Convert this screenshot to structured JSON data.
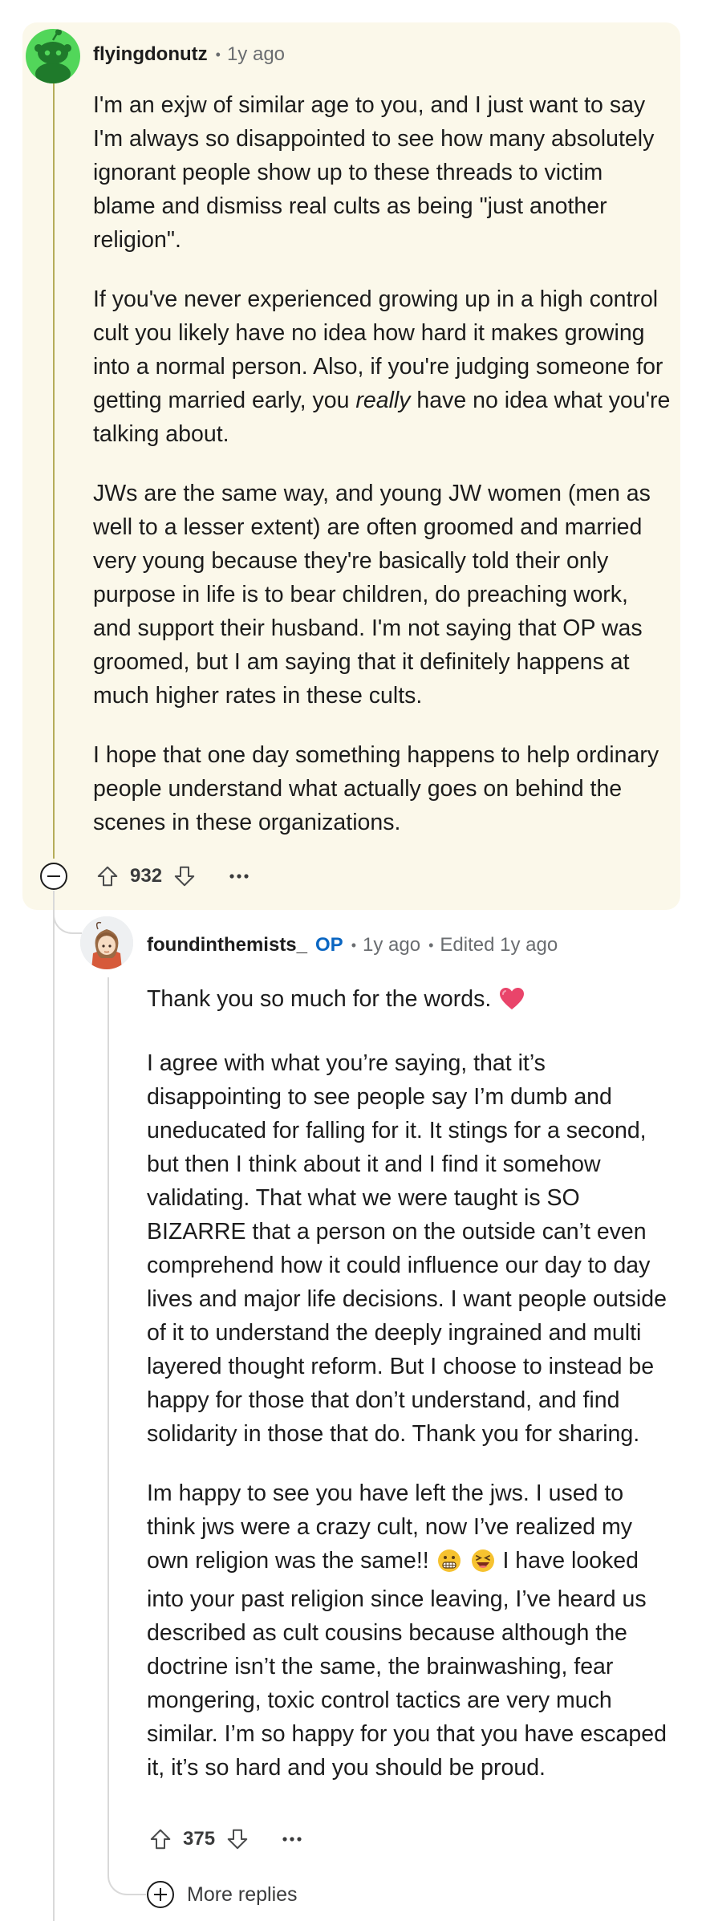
{
  "comment": {
    "author": "flyingdonutz",
    "age": "1y ago",
    "paragraphs": [
      {
        "text": "I'm an exjw of similar age to you, and I just want to say I'm always so disappointed to see how many absolutely ignorant people show up to these threads to victim blame and dismiss real cults as being \"just another religion\"."
      },
      {
        "text_before": "If you've never experienced growing up in a high control cult you likely have no idea how hard it makes growing into a normal person. Also, if you're judging someone for getting married early, you ",
        "text_emph": "really",
        "text_after": " have no idea what you're talking about."
      },
      {
        "text": "JWs are the same way, and young JW women (men as well to a lesser extent) are often groomed and married very young because they're basically told their only purpose in life is to bear children, do preaching work, and support their husband. I'm not saying that OP was groomed, but I am saying that it definitely happens at much higher rates in these cults."
      },
      {
        "text": "I hope that one day something happens to help ordinary people understand what actually goes on behind the scenes in these organizations."
      }
    ],
    "score": "932",
    "icons": {
      "collapse": "collapse-icon",
      "upvote": "upvote-icon",
      "downvote": "downvote-icon",
      "more": "more-options-icon"
    },
    "colors": {
      "card_background": "#fbf8ea",
      "avatar_background": "#52d65a",
      "thread_line": "#b5ad5a"
    }
  },
  "reply": {
    "author": "foundinthemists_",
    "op_badge": "OP",
    "age": "1y ago",
    "edited": "Edited 1y ago",
    "paragraphs": [
      {
        "text": "Thank you so much for the words.",
        "emoji_after": "heart-emoji"
      },
      {
        "text": "I agree with what you’re saying, that it’s disappointing to see people say I’m dumb and uneducated for falling for it. It stings for a second, but then I think about it and I find it somehow validating. That what we were taught is SO BIZARRE that a person on the outside can’t even comprehend how it could influence our day to day lives and major life decisions. I want people outside of it to understand the deeply ingrained and multi layered thought reform. But I choose to instead be happy for those that don’t understand, and find solidarity in those that do. Thank you for sharing."
      },
      {
        "text_before": "Im happy to see you have left the jws. I used to think jws were a crazy cult, now I’ve realized my own religion was the same!!",
        "emojis": [
          "grimacing-face-emoji",
          "squinting-laughing-face-emoji"
        ],
        "text_after": "I have looked into your past religion since leaving, I’ve heard us described as cult cousins because although the doctrine isn’t the same, the brainwashing, fear mongering, toxic control tactics are very much similar. I’m so happy for you that you have escaped it, it’s so hard and you should be proud."
      }
    ],
    "score": "375",
    "more_replies": "More replies",
    "icons": {
      "upvote": "upvote-icon",
      "downvote": "downvote-icon",
      "more": "more-options-icon",
      "more_replies": "plus-circle-icon"
    },
    "colors": {
      "op_badge": "#0a66c2",
      "thread_line": "#d9d9d9"
    }
  }
}
